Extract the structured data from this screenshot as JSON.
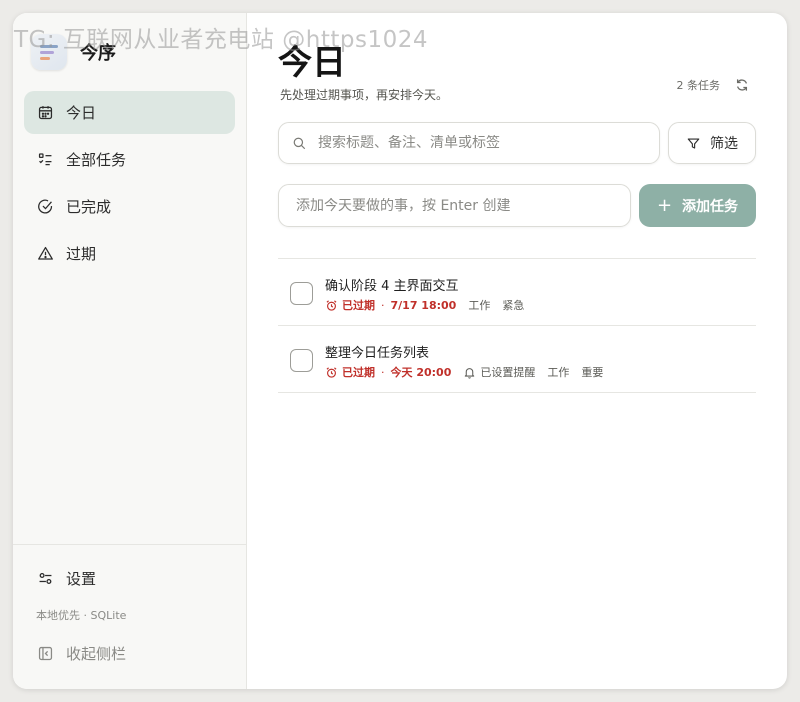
{
  "watermark": "TG: 互联网从业者充电站 @https1024",
  "app": {
    "name": "今序"
  },
  "sidebar": {
    "items": [
      {
        "label": "今日",
        "icon": "calendar-icon",
        "active": true
      },
      {
        "label": "全部任务",
        "icon": "list-icon",
        "active": false
      },
      {
        "label": "已完成",
        "icon": "check-circle-icon",
        "active": false
      },
      {
        "label": "过期",
        "icon": "warning-icon",
        "active": false
      }
    ],
    "settings_label": "设置",
    "storage_note": "本地优先 · SQLite",
    "collapse_label": "收起侧栏"
  },
  "header": {
    "title": "今日",
    "subtitle": "先处理过期事项，再安排今天。",
    "task_count": "2 条任务"
  },
  "search": {
    "placeholder": "搜索标题、备注、清单或标签"
  },
  "filter": {
    "label": "筛选"
  },
  "add_task": {
    "placeholder": "添加今天要做的事，按 Enter 创建",
    "button_label": "添加任务"
  },
  "tasks": [
    {
      "title": "确认阶段 4 主界面交互",
      "status": "已过期",
      "due": "7/17 18:00",
      "reminder": "",
      "tags": [
        "工作",
        "紧急"
      ]
    },
    {
      "title": "整理今日任务列表",
      "status": "已过期",
      "due": "今天 20:00",
      "reminder": "已设置提醒",
      "tags": [
        "工作",
        "重要"
      ]
    }
  ],
  "colors": {
    "accent": "#8eb0a6",
    "active_nav": "#dde7e2",
    "overdue": "#c0302a"
  }
}
